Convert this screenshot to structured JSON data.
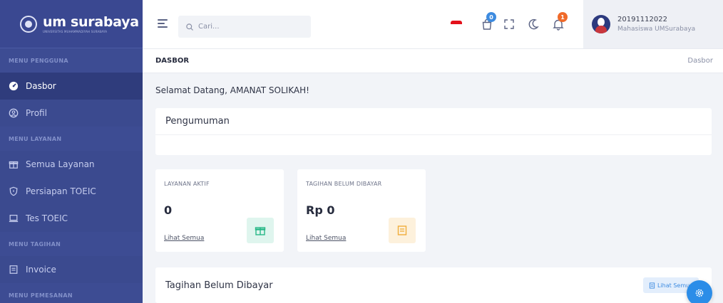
{
  "logo": {
    "title": "um surabaya",
    "subtitle": "UNIVERSITAS MUHAMMADIYAH SURABAYA"
  },
  "sidebar": {
    "sections": [
      {
        "label": "MENU PENGGUNA",
        "items": [
          {
            "label": "Dasbor",
            "icon": "dashboard-icon",
            "active": true
          },
          {
            "label": "Profil",
            "icon": "user-circle-icon",
            "active": false
          }
        ]
      },
      {
        "label": "MENU LAYANAN",
        "items": [
          {
            "label": "Semua Layanan",
            "icon": "gift-icon",
            "active": false
          },
          {
            "label": "Persiapan TOEIC",
            "icon": "shield-icon",
            "active": false
          },
          {
            "label": "Tes TOEIC",
            "icon": "laptop-icon",
            "active": false
          }
        ]
      },
      {
        "label": "MENU TAGIHAN",
        "items": [
          {
            "label": "Invoice",
            "icon": "invoice-icon",
            "active": false
          }
        ]
      },
      {
        "label": "MENU PEMESANAN",
        "items": []
      }
    ]
  },
  "topbar": {
    "search_placeholder": "Cari...",
    "cart_badge": "0",
    "notification_badge": "1",
    "user": {
      "id": "20191112022",
      "role": "Mahasiswa UMSurabaya"
    }
  },
  "breadcrumb": {
    "title": "DASBOR",
    "trail": "Dasbor"
  },
  "main": {
    "welcome": "Selamat Datang, AMANAT SOLIKAH!",
    "announcement_title": "Pengumuman",
    "stats": [
      {
        "label": "LAYANAN AKTIF",
        "value": "0",
        "link": "Lihat Semua",
        "icon": "gift-icon"
      },
      {
        "label": "TAGIHAN BELUM DIBAYAR",
        "value": "Rp 0",
        "link": "Lihat Semua",
        "icon": "invoice-icon"
      }
    ],
    "bills_title": "Tagihan Belum Dibayar",
    "bills_button": "Lihat Semua"
  },
  "colors": {
    "sidebar_bg": "#3b4a8f",
    "sidebar_active": "#2f3c7c",
    "accent_blue": "#2b8de8",
    "badge_blue": "#3d8be0",
    "badge_orange": "#f06a2a",
    "stat_green_bg": "#dff5ee",
    "stat_green": "#27b787",
    "stat_yellow_bg": "#fdf1dc",
    "stat_yellow": "#f0ad3b"
  }
}
